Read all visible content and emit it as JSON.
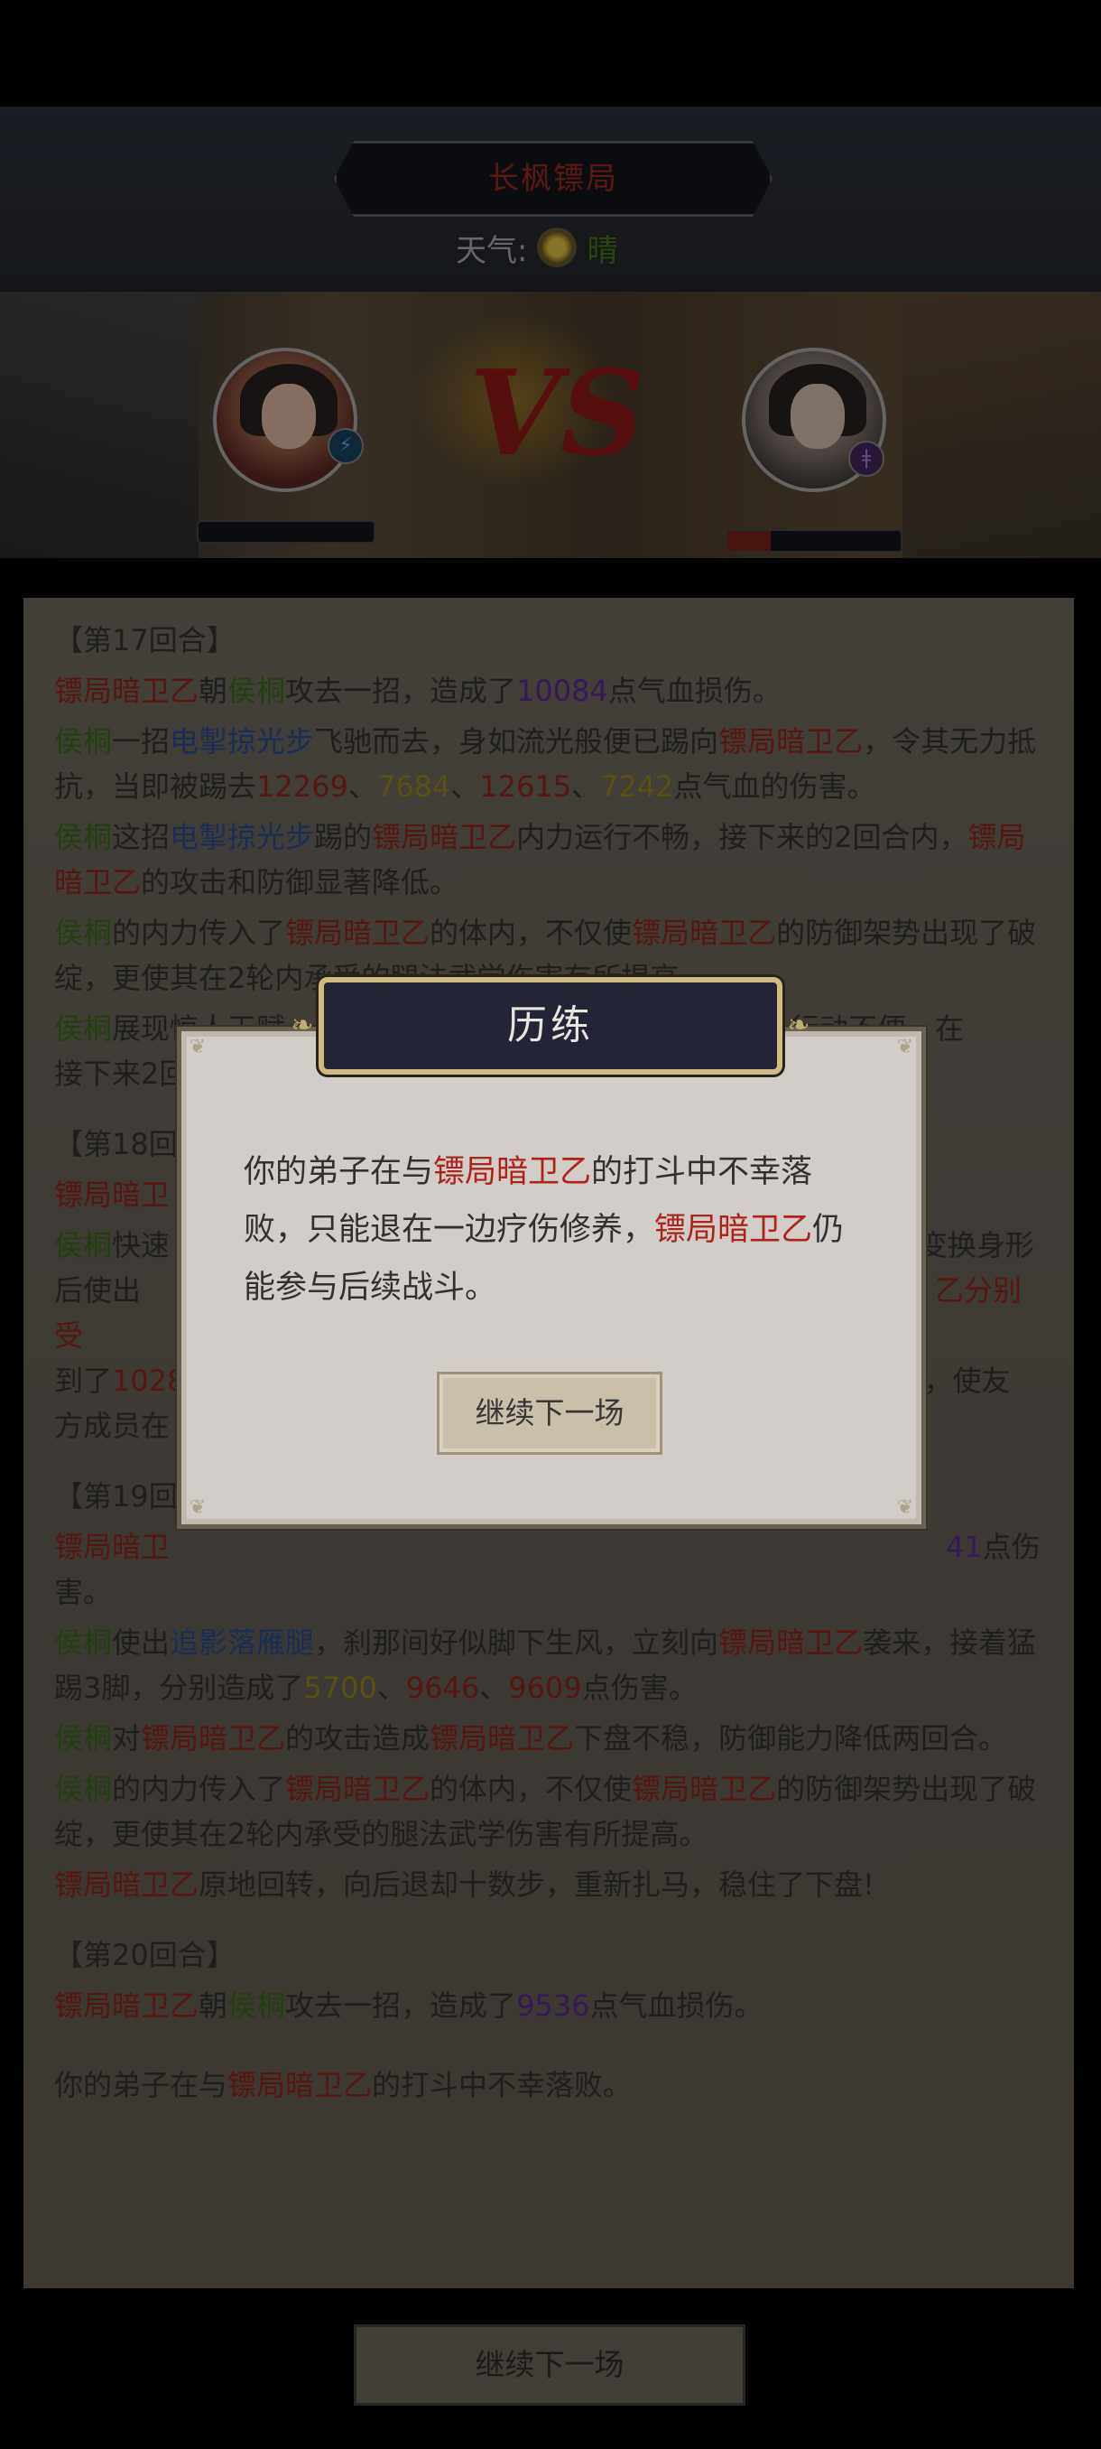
{
  "header": {
    "title": "长枫镖局",
    "weather_label": "天气:",
    "weather_icon": "sun-icon",
    "weather_state": "晴"
  },
  "battle": {
    "vs_text": "VS",
    "left_fighter": {
      "role": "player disciple",
      "hp_fraction": 0.0
    },
    "right_fighter": {
      "role": "enemy",
      "hp_fraction": 0.25
    }
  },
  "colors": {
    "enemy_name": "#b4251c",
    "ally_name": "#3e8a1c",
    "skill": "#2c5cc8",
    "damage_purple": "#6a2aa8",
    "modal_title_bg": "#25273a"
  },
  "log": {
    "round17": "【第17回合】",
    "l1": [
      "镖局暗卫乙",
      "朝",
      "侯桐",
      "攻去一招，造成了",
      "10084",
      "点气血损伤。"
    ],
    "l2": [
      "侯桐",
      "一招",
      "电掣掠光步",
      "飞驰而去，身如流光般便已踢向",
      "镖局暗卫乙",
      "，令其无力抵抗，当即被踢去",
      "12269",
      "、",
      "7684",
      "、",
      "12615",
      "、",
      "7242",
      "点气血的伤害。"
    ],
    "l3": [
      "侯桐",
      "这招",
      "电掣掠光步",
      "踢的",
      "镖局暗卫乙",
      "内力运行不畅，接下来的2回合内，",
      "镖局暗卫乙",
      "的攻击和防御显著降低。"
    ],
    "l4": [
      "侯桐",
      "的内力传入了",
      "镖局暗卫乙",
      "的体内，不仅使",
      "镖局暗卫乙",
      "的防御架势出现了破绽，更使其在2轮内承受的腿法武学伤害有所提高。"
    ],
    "l5": [
      "侯桐",
      "展现惊人天赋",
      "行动不便，在",
      "接下来2回"
    ],
    "round18": "【第18回",
    "l6": [
      "镖局暗卫"
    ],
    "l7": [
      "侯桐",
      "快速",
      "变换身形",
      "后使出",
      "乙分别受",
      "到了",
      "1028",
      "，使友",
      "方成员在"
    ],
    "round19": "【第19回",
    "l8": [
      "镖局暗卫",
      "41",
      "点伤",
      "害。"
    ],
    "l9": [
      "侯桐",
      "使出",
      "追影落雁腿",
      "，刹那间好似脚下生风，立刻向",
      "镖局暗卫乙",
      "袭来，接着猛踢3脚，分别造成了",
      "5700",
      "、",
      "9646",
      "、",
      "9609",
      "点伤害。"
    ],
    "l10": [
      "侯桐",
      "对",
      "镖局暗卫乙",
      "的攻击造成",
      "镖局暗卫乙",
      "下盘不稳，防御能力降低两回合。"
    ],
    "l11": [
      "侯桐",
      "的内力传入了",
      "镖局暗卫乙",
      "的体内，不仅使",
      "镖局暗卫乙",
      "的防御架势出现了破绽，更使其在2轮内承受的腿法武学伤害有所提高。"
    ],
    "l12": [
      "镖局暗卫乙",
      "原地回转，向后退却十数步，重新扎马，稳住了下盘!"
    ],
    "round20": "【第20回合】",
    "l13": [
      "镖局暗卫乙",
      "朝",
      "侯桐",
      "攻去一招，造成了",
      "9536",
      "点气血损伤。"
    ],
    "l14": [
      "你的弟子在与",
      "镖局暗卫乙",
      "的打斗中不幸落败。"
    ]
  },
  "bottom_button": "继续下一场",
  "modal": {
    "title": "历练",
    "text_parts": [
      "你的弟子在与",
      "镖局暗卫乙",
      "的打斗中不幸落败，只能退在一边疗伤修养，",
      "镖局暗卫乙",
      "仍能参与后续战斗。"
    ],
    "button": "继续下一场"
  }
}
